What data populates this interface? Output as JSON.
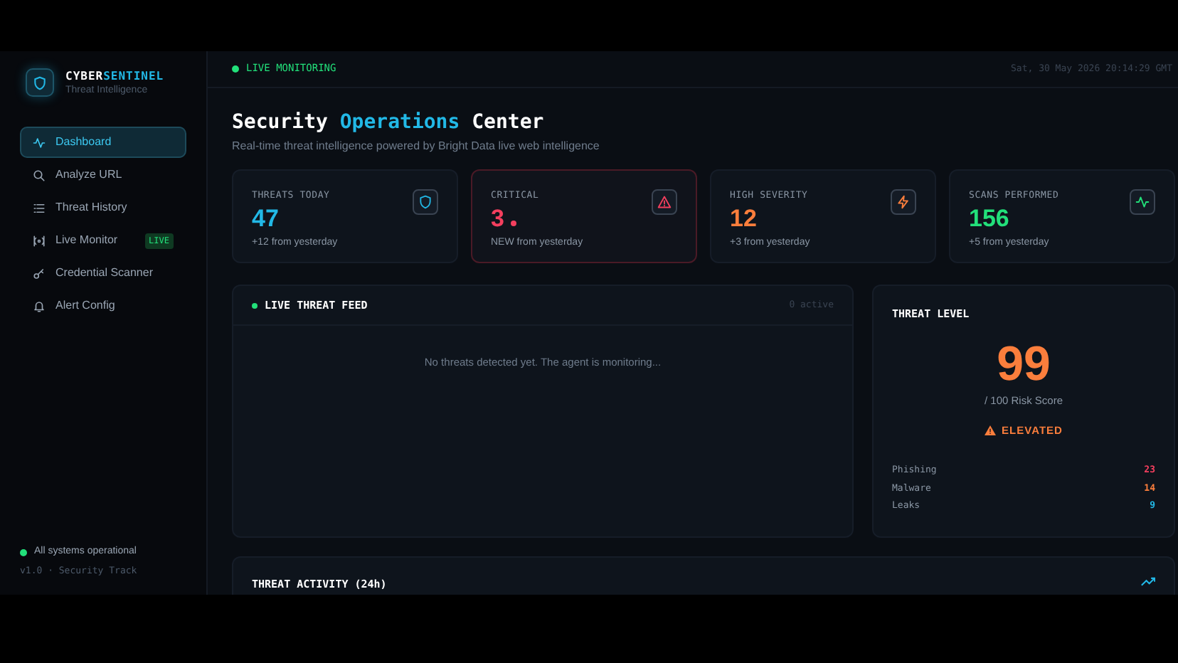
{
  "brand": {
    "name_part_1": "CYBER",
    "name_part_2": "SENTINEL",
    "tagline": "Threat Intelligence"
  },
  "nav": [
    {
      "kind": "pulse",
      "label": "Dashboard",
      "selected": true
    },
    {
      "kind": "search",
      "label": "Analyze URL",
      "selected": false
    },
    {
      "kind": "list",
      "label": "Threat History",
      "selected": false
    },
    {
      "kind": "radio",
      "label": "Live Monitor",
      "selected": false,
      "badge": "LIVE"
    },
    {
      "kind": "key",
      "label": "Credential Scanner",
      "selected": false
    },
    {
      "kind": "bell",
      "label": "Alert Config",
      "selected": false
    }
  ],
  "sidebar_footer": {
    "status": "All systems operational",
    "version": "v1.0 · Security Track"
  },
  "top_bar": {
    "status": "LIVE MONITORING",
    "timestamp": "Sat, 30 May 2026 20:14:29 GMT"
  },
  "header": {
    "title_part_1": "Security",
    "title_part_2": "Operations",
    "title_part_3": "Center",
    "subtitle": "Real-time threat intelligence powered by Bright Data live web intelligence"
  },
  "stat_cards": [
    {
      "kind": "shield",
      "label": "THREATS TODAY",
      "value": "47",
      "note": "+12 from yesterday",
      "color": "#22b8e6",
      "highlighted": false,
      "alert_dot": false
    },
    {
      "kind": "alert",
      "label": "CRITICAL",
      "value": "3",
      "note": "NEW from yesterday",
      "color": "#f43f5e",
      "highlighted": true,
      "alert_dot": true
    },
    {
      "kind": "zap",
      "label": "HIGH SEVERITY",
      "value": "12",
      "note": "+3 from yesterday",
      "color": "#fb7e3c",
      "highlighted": false,
      "alert_dot": false
    },
    {
      "kind": "pulse",
      "label": "SCANS PERFORMED",
      "value": "156",
      "note": "+5 from yesterday",
      "color": "#22e07a",
      "highlighted": false,
      "alert_dot": false
    }
  ],
  "threat_feed": {
    "title": "LIVE THREAT FEED",
    "count": "0 active",
    "empty_message": "No threats detected yet. The agent is monitoring..."
  },
  "threat_level": {
    "title": "THREAT LEVEL",
    "score": "99",
    "score_caption": "/ 100 Risk Score",
    "status": "ELEVATED",
    "breakdown": [
      {
        "label": "Phishing",
        "value": "23",
        "color": "#f43f5e"
      },
      {
        "label": "Malware",
        "value": "14",
        "color": "#fb7e3c"
      },
      {
        "label": "Leaks",
        "value": "9",
        "color": "#22b8e6"
      }
    ]
  },
  "threat_activity": {
    "title": "THREAT ACTIVITY (24h)"
  }
}
